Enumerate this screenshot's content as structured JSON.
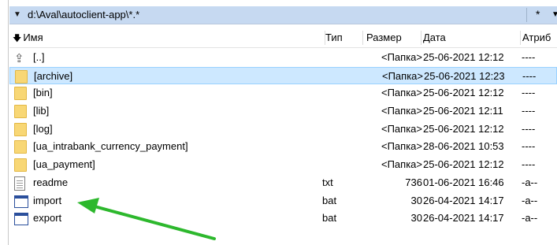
{
  "path_bar": {
    "path": "d:\\Aval\\autoclient-app\\*.*",
    "filter_symbol": "*"
  },
  "columns": {
    "name": "Имя",
    "ext": "Тип",
    "size": "Размер",
    "date": "Дата",
    "attr": "Атриб"
  },
  "rows": [
    {
      "icon": "up-dir-icon",
      "name": "[..]",
      "ext": "",
      "size": "<Папка>",
      "date": "25-06-2021 12:12",
      "attr": "----",
      "selected": false
    },
    {
      "icon": "folder-icon",
      "name": "[archive]",
      "ext": "",
      "size": "<Папка>",
      "date": "25-06-2021 12:23",
      "attr": "----",
      "selected": true
    },
    {
      "icon": "folder-icon",
      "name": "[bin]",
      "ext": "",
      "size": "<Папка>",
      "date": "25-06-2021 12:12",
      "attr": "----",
      "selected": false
    },
    {
      "icon": "folder-icon",
      "name": "[lib]",
      "ext": "",
      "size": "<Папка>",
      "date": "25-06-2021 12:11",
      "attr": "----",
      "selected": false
    },
    {
      "icon": "folder-icon",
      "name": "[log]",
      "ext": "",
      "size": "<Папка>",
      "date": "25-06-2021 12:12",
      "attr": "----",
      "selected": false
    },
    {
      "icon": "folder-icon",
      "name": "[ua_intrabank_currency_payment]",
      "ext": "",
      "size": "<Папка>",
      "date": "28-06-2021 10:53",
      "attr": "----",
      "selected": false
    },
    {
      "icon": "folder-icon",
      "name": "[ua_payment]",
      "ext": "",
      "size": "<Папка>",
      "date": "25-06-2021 12:12",
      "attr": "----",
      "selected": false
    },
    {
      "icon": "text-file-icon",
      "name": "readme",
      "ext": "txt",
      "size": "736",
      "date": "01-06-2021 16:46",
      "attr": "-a--",
      "selected": false
    },
    {
      "icon": "batch-file-icon",
      "name": "import",
      "ext": "bat",
      "size": "30",
      "date": "26-04-2021 14:17",
      "attr": "-a--",
      "selected": false
    },
    {
      "icon": "batch-file-icon",
      "name": "export",
      "ext": "bat",
      "size": "30",
      "date": "26-04-2021 14:17",
      "attr": "-a--",
      "selected": false
    }
  ],
  "annotation": {
    "color": "#2db82d",
    "target": "import"
  },
  "colors": {
    "path_bar": "#c6d9f1",
    "selection": "#cde8ff",
    "folder": "#f8d775"
  }
}
